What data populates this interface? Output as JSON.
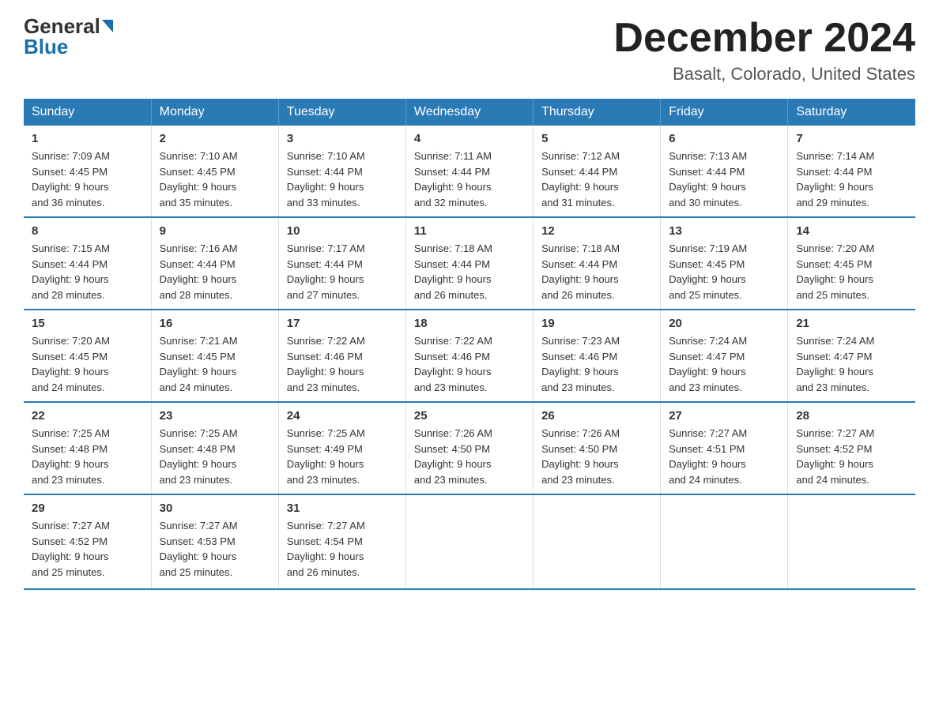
{
  "logo": {
    "general": "General",
    "blue": "Blue"
  },
  "title": {
    "month_year": "December 2024",
    "location": "Basalt, Colorado, United States"
  },
  "days_of_week": [
    "Sunday",
    "Monday",
    "Tuesday",
    "Wednesday",
    "Thursday",
    "Friday",
    "Saturday"
  ],
  "weeks": [
    [
      {
        "day": "1",
        "sunrise": "7:09 AM",
        "sunset": "4:45 PM",
        "daylight": "9 hours and 36 minutes."
      },
      {
        "day": "2",
        "sunrise": "7:10 AM",
        "sunset": "4:45 PM",
        "daylight": "9 hours and 35 minutes."
      },
      {
        "day": "3",
        "sunrise": "7:10 AM",
        "sunset": "4:44 PM",
        "daylight": "9 hours and 33 minutes."
      },
      {
        "day": "4",
        "sunrise": "7:11 AM",
        "sunset": "4:44 PM",
        "daylight": "9 hours and 32 minutes."
      },
      {
        "day": "5",
        "sunrise": "7:12 AM",
        "sunset": "4:44 PM",
        "daylight": "9 hours and 31 minutes."
      },
      {
        "day": "6",
        "sunrise": "7:13 AM",
        "sunset": "4:44 PM",
        "daylight": "9 hours and 30 minutes."
      },
      {
        "day": "7",
        "sunrise": "7:14 AM",
        "sunset": "4:44 PM",
        "daylight": "9 hours and 29 minutes."
      }
    ],
    [
      {
        "day": "8",
        "sunrise": "7:15 AM",
        "sunset": "4:44 PM",
        "daylight": "9 hours and 28 minutes."
      },
      {
        "day": "9",
        "sunrise": "7:16 AM",
        "sunset": "4:44 PM",
        "daylight": "9 hours and 28 minutes."
      },
      {
        "day": "10",
        "sunrise": "7:17 AM",
        "sunset": "4:44 PM",
        "daylight": "9 hours and 27 minutes."
      },
      {
        "day": "11",
        "sunrise": "7:18 AM",
        "sunset": "4:44 PM",
        "daylight": "9 hours and 26 minutes."
      },
      {
        "day": "12",
        "sunrise": "7:18 AM",
        "sunset": "4:44 PM",
        "daylight": "9 hours and 26 minutes."
      },
      {
        "day": "13",
        "sunrise": "7:19 AM",
        "sunset": "4:45 PM",
        "daylight": "9 hours and 25 minutes."
      },
      {
        "day": "14",
        "sunrise": "7:20 AM",
        "sunset": "4:45 PM",
        "daylight": "9 hours and 25 minutes."
      }
    ],
    [
      {
        "day": "15",
        "sunrise": "7:20 AM",
        "sunset": "4:45 PM",
        "daylight": "9 hours and 24 minutes."
      },
      {
        "day": "16",
        "sunrise": "7:21 AM",
        "sunset": "4:45 PM",
        "daylight": "9 hours and 24 minutes."
      },
      {
        "day": "17",
        "sunrise": "7:22 AM",
        "sunset": "4:46 PM",
        "daylight": "9 hours and 23 minutes."
      },
      {
        "day": "18",
        "sunrise": "7:22 AM",
        "sunset": "4:46 PM",
        "daylight": "9 hours and 23 minutes."
      },
      {
        "day": "19",
        "sunrise": "7:23 AM",
        "sunset": "4:46 PM",
        "daylight": "9 hours and 23 minutes."
      },
      {
        "day": "20",
        "sunrise": "7:24 AM",
        "sunset": "4:47 PM",
        "daylight": "9 hours and 23 minutes."
      },
      {
        "day": "21",
        "sunrise": "7:24 AM",
        "sunset": "4:47 PM",
        "daylight": "9 hours and 23 minutes."
      }
    ],
    [
      {
        "day": "22",
        "sunrise": "7:25 AM",
        "sunset": "4:48 PM",
        "daylight": "9 hours and 23 minutes."
      },
      {
        "day": "23",
        "sunrise": "7:25 AM",
        "sunset": "4:48 PM",
        "daylight": "9 hours and 23 minutes."
      },
      {
        "day": "24",
        "sunrise": "7:25 AM",
        "sunset": "4:49 PM",
        "daylight": "9 hours and 23 minutes."
      },
      {
        "day": "25",
        "sunrise": "7:26 AM",
        "sunset": "4:50 PM",
        "daylight": "9 hours and 23 minutes."
      },
      {
        "day": "26",
        "sunrise": "7:26 AM",
        "sunset": "4:50 PM",
        "daylight": "9 hours and 23 minutes."
      },
      {
        "day": "27",
        "sunrise": "7:27 AM",
        "sunset": "4:51 PM",
        "daylight": "9 hours and 24 minutes."
      },
      {
        "day": "28",
        "sunrise": "7:27 AM",
        "sunset": "4:52 PM",
        "daylight": "9 hours and 24 minutes."
      }
    ],
    [
      {
        "day": "29",
        "sunrise": "7:27 AM",
        "sunset": "4:52 PM",
        "daylight": "9 hours and 25 minutes."
      },
      {
        "day": "30",
        "sunrise": "7:27 AM",
        "sunset": "4:53 PM",
        "daylight": "9 hours and 25 minutes."
      },
      {
        "day": "31",
        "sunrise": "7:27 AM",
        "sunset": "4:54 PM",
        "daylight": "9 hours and 26 minutes."
      },
      {
        "day": "",
        "sunrise": "",
        "sunset": "",
        "daylight": ""
      },
      {
        "day": "",
        "sunrise": "",
        "sunset": "",
        "daylight": ""
      },
      {
        "day": "",
        "sunrise": "",
        "sunset": "",
        "daylight": ""
      },
      {
        "day": "",
        "sunrise": "",
        "sunset": "",
        "daylight": ""
      }
    ]
  ],
  "labels": {
    "sunrise": "Sunrise:",
    "sunset": "Sunset:",
    "daylight": "Daylight:"
  }
}
